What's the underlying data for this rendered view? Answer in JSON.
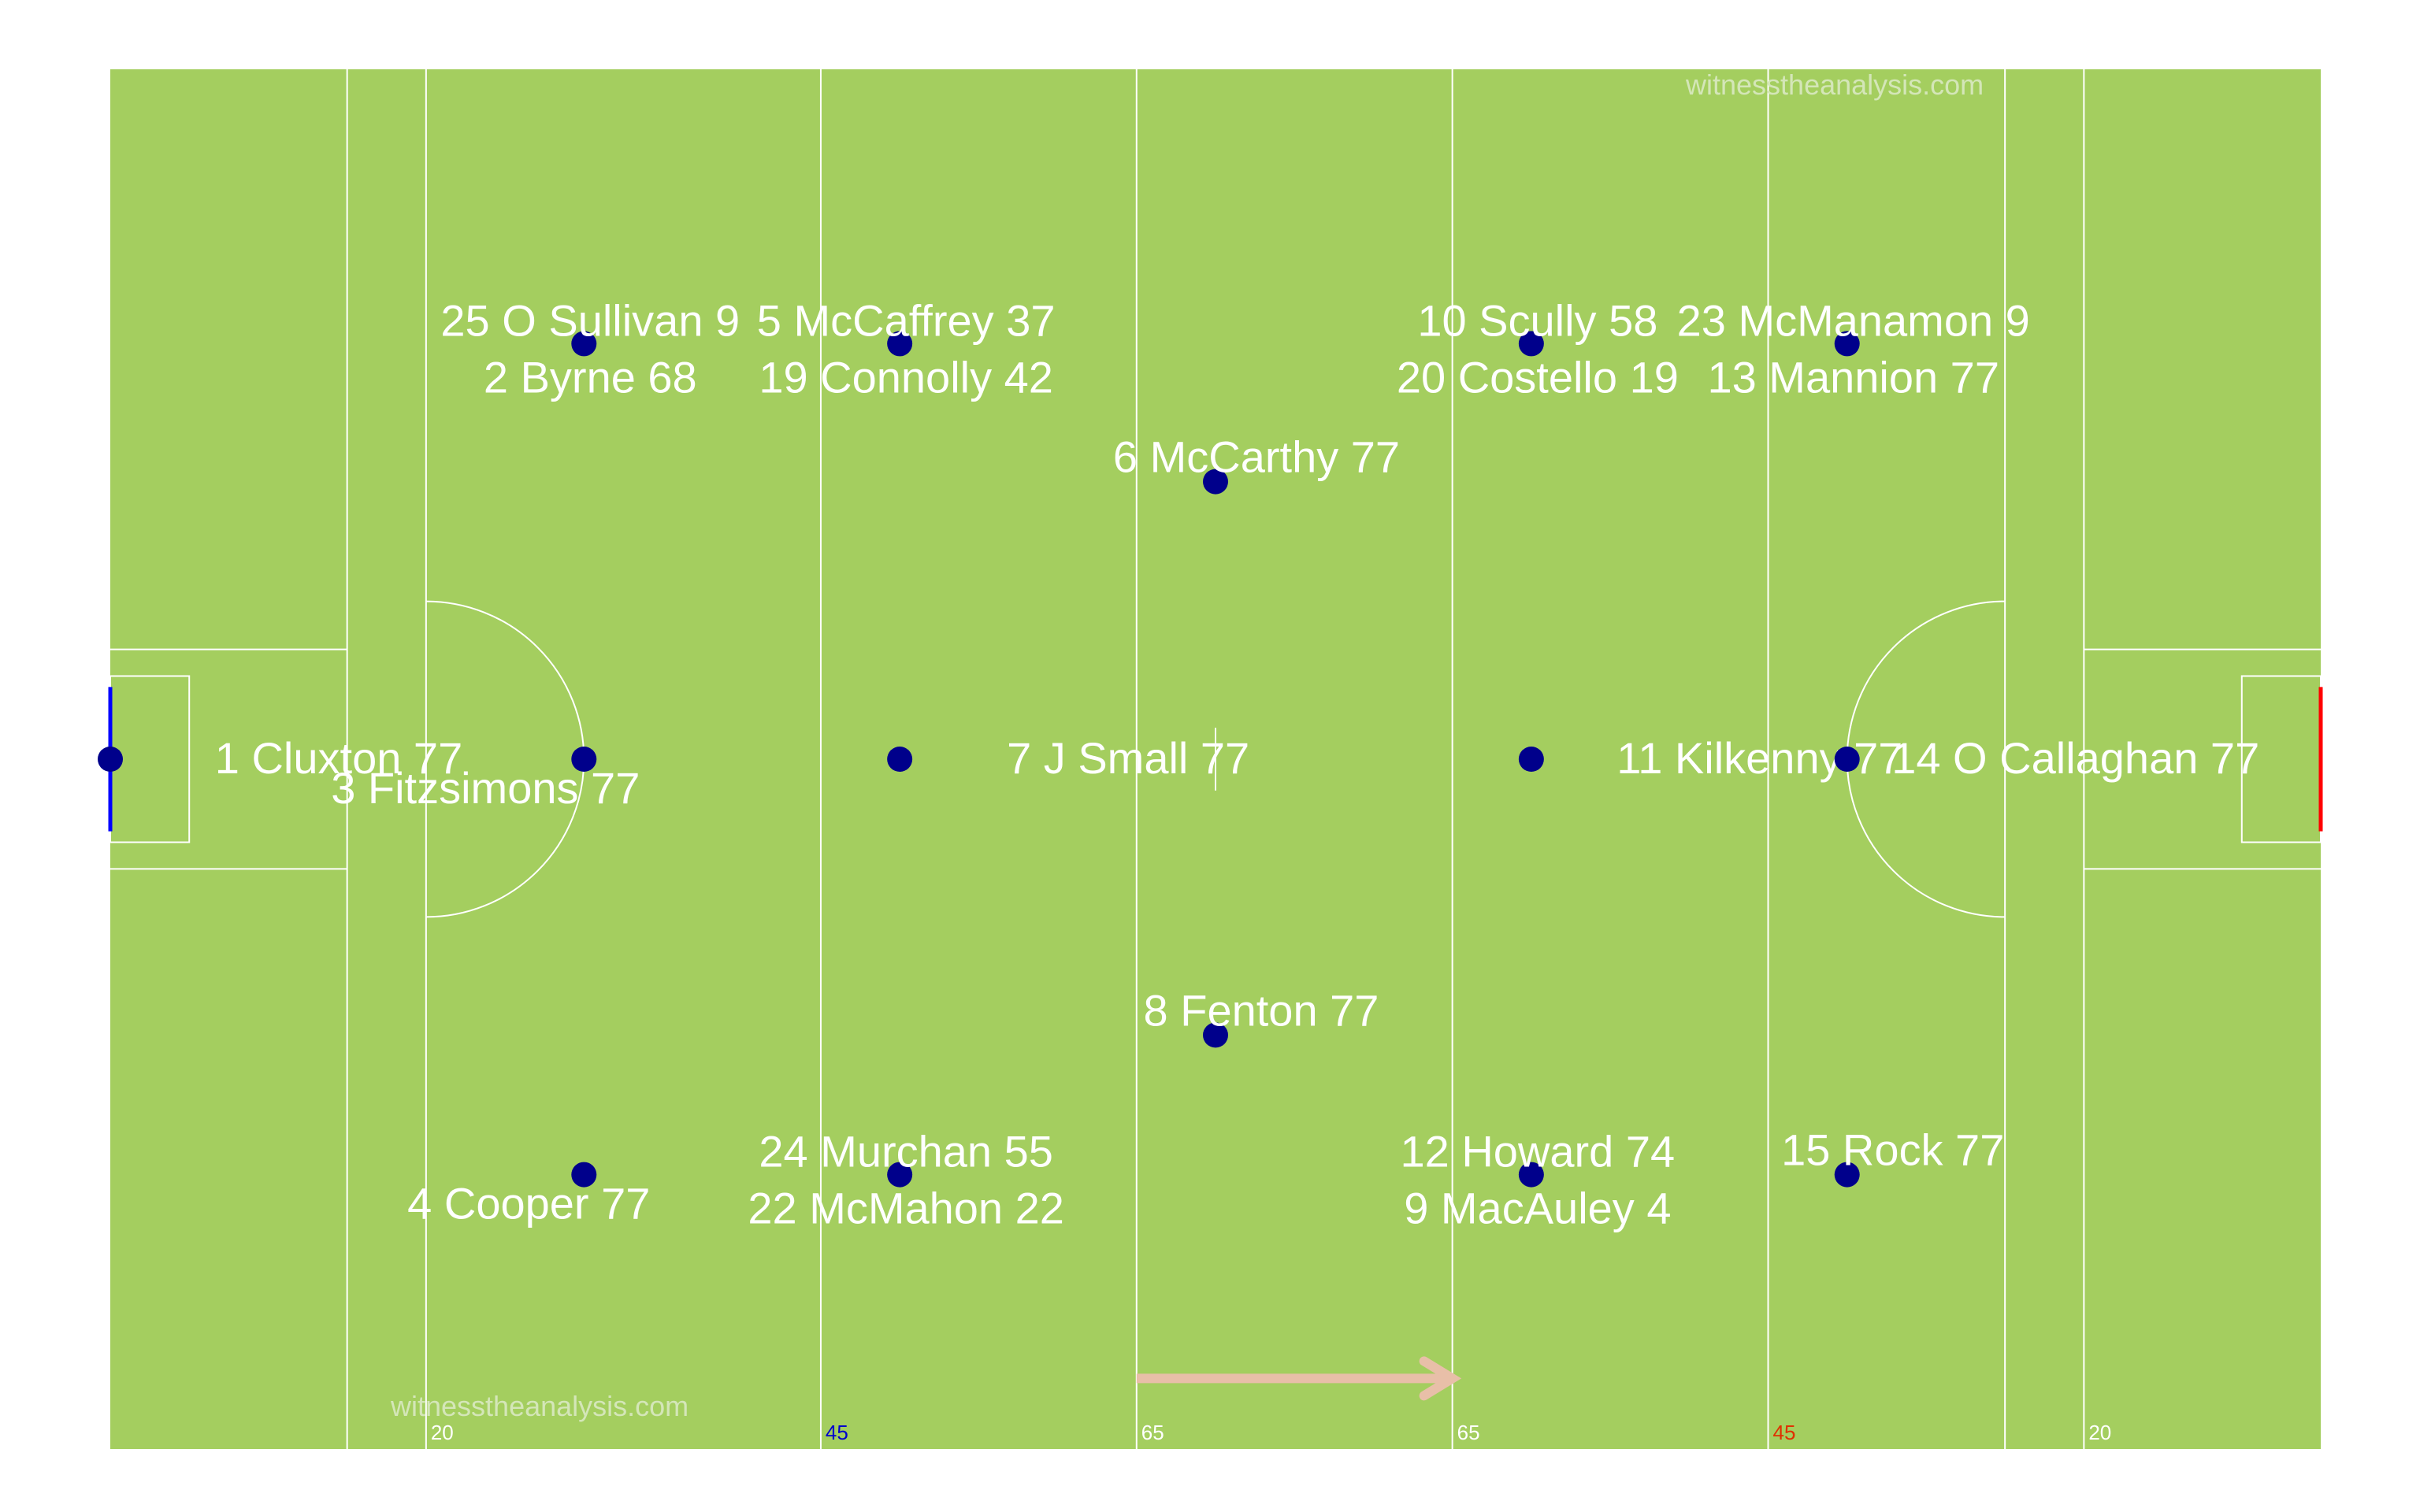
{
  "chart_data": {
    "type": "scatter",
    "title": "",
    "xlabel": "",
    "ylabel": "",
    "xlim": [
      0,
      140
    ],
    "ylim": [
      0,
      88
    ],
    "grid": false,
    "colors": {
      "pitch": "#a4ce5f",
      "lines": "#ffffff",
      "player": "#00008b",
      "home_goal": "#0000ff",
      "away_goal": "#ff0000",
      "tick_blue": "#0000cd",
      "tick_red": "#e03000",
      "arrow": "#e8bfa8"
    },
    "pitch_line_labels": [
      {
        "x": 20,
        "text": "20",
        "color": "white"
      },
      {
        "x": 45,
        "text": "45",
        "color": "blue"
      },
      {
        "x": 65,
        "text": "65",
        "color": "white"
      },
      {
        "x": 85,
        "text": "65",
        "color": "white"
      },
      {
        "x": 105,
        "text": "45",
        "color": "red"
      },
      {
        "x": 125,
        "text": "20",
        "color": "white"
      }
    ],
    "direction_arrow": {
      "from": 65,
      "to": 85
    },
    "positions": [
      {
        "x": 0,
        "y": 44,
        "labels": [
          "1 Cluxton 77"
        ]
      },
      {
        "x": 30,
        "y": 70.5,
        "labels": [
          "25 O Sullivan 9",
          "2 Byrne 68"
        ]
      },
      {
        "x": 30,
        "y": 44,
        "labels": [
          "3 Fitzsimons 77"
        ]
      },
      {
        "x": 30,
        "y": 17.5,
        "labels": [
          "4 Cooper 77"
        ]
      },
      {
        "x": 50,
        "y": 70.5,
        "labels": [
          "5 McCaffrey 37",
          "19 Connolly 42"
        ]
      },
      {
        "x": 70,
        "y": 61.7,
        "labels": [
          "6 McCarthy 77"
        ]
      },
      {
        "x": 50,
        "y": 44,
        "labels": [
          "7 J Small 77"
        ]
      },
      {
        "x": 70,
        "y": 26.4,
        "labels": [
          "8 Fenton 77"
        ]
      },
      {
        "x": 50,
        "y": 17.5,
        "labels": [
          "24 Murchan 55",
          "22 McMahon 22"
        ]
      },
      {
        "x": 90,
        "y": 70.5,
        "labels": [
          "10 Scully 58",
          "20 Costello 19"
        ]
      },
      {
        "x": 90,
        "y": 44,
        "labels": [
          "11 Kilkenny 77"
        ]
      },
      {
        "x": 90,
        "y": 17.5,
        "labels": [
          "12 Howard 74",
          "9 MacAuley 4"
        ]
      },
      {
        "x": 110,
        "y": 70.5,
        "labels": [
          "23 McManamon 9",
          "13 Mannion 77"
        ]
      },
      {
        "x": 110,
        "y": 44,
        "labels": [
          "14 O Callaghan 77"
        ]
      },
      {
        "x": 110,
        "y": 17.5,
        "labels": [
          "15 Rock 77"
        ]
      }
    ]
  },
  "watermark": "witnesstheanalysis.com"
}
